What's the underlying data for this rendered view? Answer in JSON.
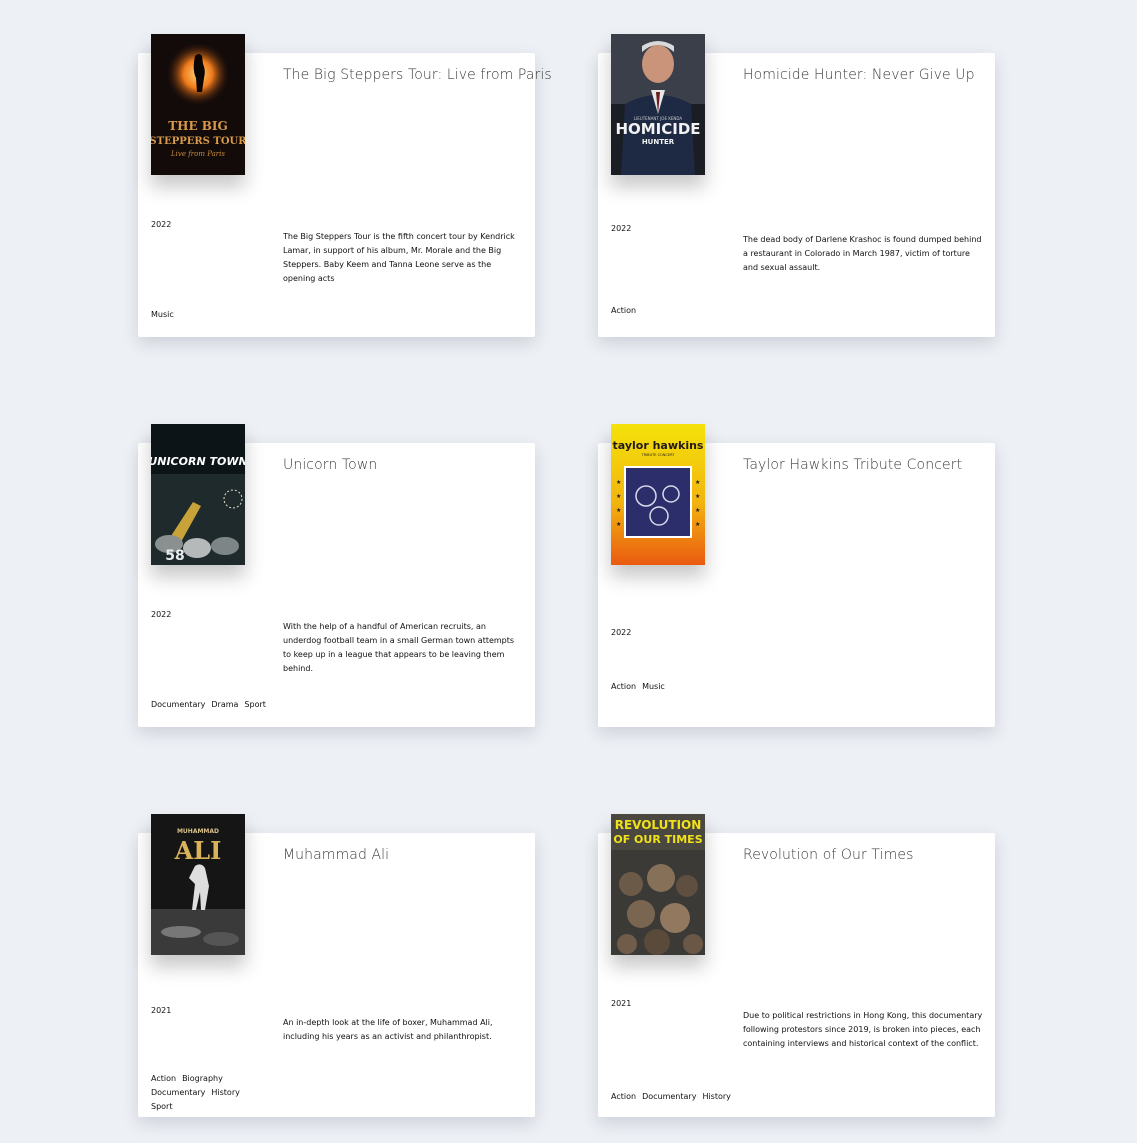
{
  "movies": [
    {
      "title": "The Big Steppers Tour: Live from Paris",
      "year": "2022",
      "description": "The Big Steppers Tour is the fifth concert tour by Kendrick Lamar, in support of his album, Mr. Morale and the Big Steppers. Baby Keem and Tanna Leone serve as the opening acts",
      "genres": [
        "Music"
      ],
      "poster": {
        "icon": "poster-big-steppers",
        "text": [
          "THE BIG",
          "STEPPERS TOUR",
          "Live from Paris"
        ]
      }
    },
    {
      "title": "Homicide Hunter: Never Give Up",
      "year": "2022",
      "description": "The dead body of Darlene Krashoc is found dumped behind a restaurant in Colorado in March 1987, victim of torture and sexual assault.",
      "genres": [
        "Action"
      ],
      "poster": {
        "icon": "poster-homicide-hunter",
        "text": [
          "LIEUTENANT JOE KENDA",
          "HOMICIDE",
          "HUNTER"
        ]
      }
    },
    {
      "title": "Unicorn Town",
      "year": "2022",
      "description": "With the help of a handful of American recruits, an underdog football team in a small German town attempts to keep up in a league that appears to be leaving them behind.",
      "genres": [
        "Documentary",
        "Drama",
        "Sport"
      ],
      "poster": {
        "icon": "poster-unicorn-town",
        "text": [
          "UNICORN TOWN",
          "58"
        ]
      }
    },
    {
      "title": "Taylor Hawkins Tribute Concert",
      "year": "2022",
      "description": "",
      "genres": [
        "Action",
        "Music"
      ],
      "poster": {
        "icon": "poster-taylor-hawkins",
        "text": [
          "taylor hawkins",
          "TRIBUTE CONCERT"
        ]
      }
    },
    {
      "title": "Muhammad Ali",
      "year": "2021",
      "description": "An in-depth look at the life of boxer, Muhammad Ali, including his years as an activist and philanthropist.",
      "genres": [
        "Action",
        "Biography",
        "Documentary",
        "History",
        "Sport"
      ],
      "poster": {
        "icon": "poster-muhammad-ali",
        "text": [
          "MUHAMMAD",
          "ALI"
        ]
      }
    },
    {
      "title": "Revolution of Our Times",
      "year": "2021",
      "description": "Due to political restrictions in Hong Kong, this documentary following protestors since 2019, is broken into pieces, each containing interviews and historical context of the conflict.",
      "genres": [
        "Action",
        "Documentary",
        "History"
      ],
      "poster": {
        "icon": "poster-revolution-of-our-times",
        "text": [
          "REVOLUTION",
          "OF OUR TIMES"
        ]
      }
    }
  ],
  "colors": {
    "background": "#edf0f5",
    "card": "#ffffff",
    "text": "#111111",
    "title": "#3b3b3b"
  }
}
